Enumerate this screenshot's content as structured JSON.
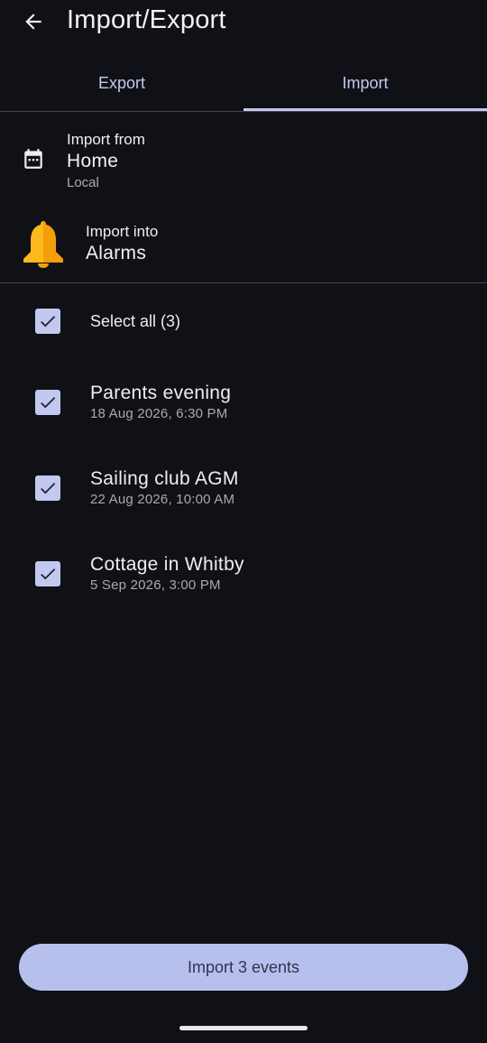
{
  "appbar": {
    "title": "Import/Export",
    "back_icon": "arrow-back-icon"
  },
  "tabs": [
    {
      "label": "Export",
      "active": false
    },
    {
      "label": "Import",
      "active": true
    }
  ],
  "source": {
    "heading": "Import from",
    "name": "Home",
    "sub": "Local",
    "icon": "calendar-icon"
  },
  "target": {
    "heading": "Import into",
    "name": "Alarms",
    "icon": "bell-icon"
  },
  "select_all": {
    "label": "Select all (3)",
    "checked": true
  },
  "events": [
    {
      "title": "Parents evening",
      "when": "18 Aug 2026, 6:30 PM",
      "checked": true
    },
    {
      "title": "Sailing club AGM",
      "when": "22 Aug 2026, 10:00 AM",
      "checked": true
    },
    {
      "title": "Cottage in Whitby",
      "when": "5 Sep 2026, 3:00 PM",
      "checked": true
    }
  ],
  "import_button": {
    "label": "Import 3 events"
  },
  "colors": {
    "background": "#101116",
    "accent": "#c3c8f0",
    "button": "#b7c0ec",
    "bell": "#fbb91a"
  }
}
